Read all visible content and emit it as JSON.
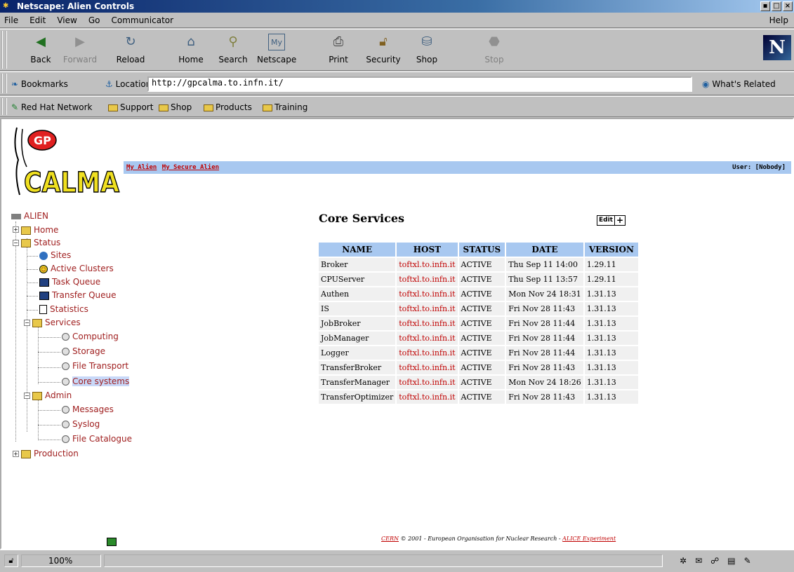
{
  "window": {
    "title": "Netscape: Alien Controls"
  },
  "menu": {
    "items": [
      "File",
      "Edit",
      "View",
      "Go",
      "Communicator"
    ],
    "help": "Help"
  },
  "toolbar": {
    "buttons": [
      {
        "label": "Back",
        "icon": "back-arrow-icon",
        "enabled": true
      },
      {
        "label": "Forward",
        "icon": "forward-arrow-icon",
        "enabled": false
      },
      {
        "label": "Reload",
        "icon": "reload-icon",
        "enabled": true
      },
      {
        "label": "Home",
        "icon": "home-icon",
        "enabled": true
      },
      {
        "label": "Search",
        "icon": "search-icon",
        "enabled": true
      },
      {
        "label": "Netscape",
        "icon": "my-netscape-icon",
        "enabled": true
      },
      {
        "label": "Print",
        "icon": "print-icon",
        "enabled": true
      },
      {
        "label": "Security",
        "icon": "security-lock-icon",
        "enabled": true
      },
      {
        "label": "Shop",
        "icon": "shop-icon",
        "enabled": true
      },
      {
        "label": "Stop",
        "icon": "stop-icon",
        "enabled": false
      }
    ],
    "logo": "N"
  },
  "location": {
    "bookmarks": "Bookmarks",
    "label": "Location:",
    "url": "http://gpcalma.to.infn.it/",
    "related": "What's Related"
  },
  "personal": {
    "items": [
      "Red Hat Network",
      "Support",
      "Shop",
      "Products",
      "Training"
    ]
  },
  "banner": {
    "link1": "My Alien",
    "link2": "My Secure Alien",
    "user": "User: [Nobody]"
  },
  "tree": {
    "root": "ALIEN",
    "home": "Home",
    "status": "Status",
    "sites": "Sites",
    "active_clusters": "Active Clusters",
    "task_queue": "Task Queue",
    "transfer_queue": "Transfer Queue",
    "statistics": "Statistics",
    "services": "Services",
    "computing": "Computing",
    "storage": "Storage",
    "file_transport": "File Transport",
    "core_systems": "Core systems",
    "admin": "Admin",
    "messages": "Messages",
    "syslog": "Syslog",
    "file_catalogue": "File Catalogue",
    "production": "Production"
  },
  "main": {
    "title": "Core Services",
    "edit": "Edit",
    "plus": "+",
    "columns": [
      "NAME",
      "HOST",
      "STATUS",
      "DATE",
      "VERSION"
    ],
    "rows": [
      [
        "Broker",
        "toftxl.to.infn.it",
        "ACTIVE",
        "Thu Sep 11 14:00",
        "1.29.11"
      ],
      [
        "CPUServer",
        "toftxl.to.infn.it",
        "ACTIVE",
        "Thu Sep 11 13:57",
        "1.29.11"
      ],
      [
        "Authen",
        "toftxl.to.infn.it",
        "ACTIVE",
        "Mon Nov 24 18:31",
        "1.31.13"
      ],
      [
        "IS",
        "toftxl.to.infn.it",
        "ACTIVE",
        "Fri Nov 28 11:43",
        "1.31.13"
      ],
      [
        "JobBroker",
        "toftxl.to.infn.it",
        "ACTIVE",
        "Fri Nov 28 11:44",
        "1.31.13"
      ],
      [
        "JobManager",
        "toftxl.to.infn.it",
        "ACTIVE",
        "Fri Nov 28 11:44",
        "1.31.13"
      ],
      [
        "Logger",
        "toftxl.to.infn.it",
        "ACTIVE",
        "Fri Nov 28 11:44",
        "1.31.13"
      ],
      [
        "TransferBroker",
        "toftxl.to.infn.it",
        "ACTIVE",
        "Fri Nov 28 11:43",
        "1.31.13"
      ],
      [
        "TransferManager",
        "toftxl.to.infn.it",
        "ACTIVE",
        "Mon Nov 24 18:26",
        "1.31.13"
      ],
      [
        "TransferOptimizer",
        "toftxl.to.infn.it",
        "ACTIVE",
        "Fri Nov 28 11:43",
        "1.31.13"
      ]
    ]
  },
  "footer": {
    "cern": "CERN",
    "text": " © 2001 - European Organisation for Nuclear Research - ",
    "alice": "ALICE Experiment"
  },
  "logo": {
    "text1": "GP",
    "text2": "CALMA"
  },
  "status": {
    "zoom": "100%"
  },
  "colors": {
    "link": "#c00000",
    "header_bg": "#a8c8f0",
    "tree_text": "#a02020"
  }
}
